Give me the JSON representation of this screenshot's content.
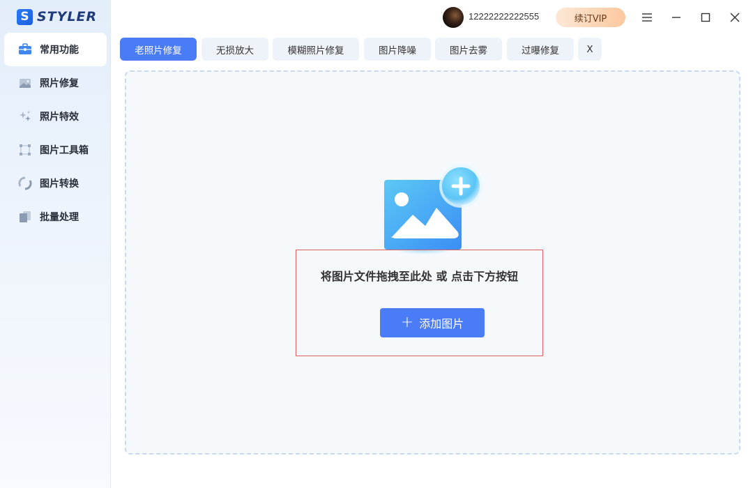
{
  "app": {
    "logo_letter": "S",
    "name": "STYLER"
  },
  "sidebar": {
    "items": [
      {
        "label": "常用功能",
        "icon": "toolbox-icon",
        "active": true
      },
      {
        "label": "照片修复",
        "icon": "photo-icon",
        "active": false
      },
      {
        "label": "照片特效",
        "icon": "sparkle-icon",
        "active": false
      },
      {
        "label": "图片工具箱",
        "icon": "crop-frame-icon",
        "active": false
      },
      {
        "label": "图片转换",
        "icon": "convert-icon",
        "active": false
      },
      {
        "label": "批量处理",
        "icon": "stack-icon",
        "active": false
      }
    ]
  },
  "titlebar": {
    "username": "12222222222555",
    "vip_label": "续订VIP",
    "window_controls": [
      "menu-icon",
      "minimize-icon",
      "maximize-icon",
      "close-icon"
    ]
  },
  "tabs": [
    {
      "label": "老照片修复",
      "active": true
    },
    {
      "label": "无损放大",
      "active": false
    },
    {
      "label": "模糊照片修复",
      "active": false
    },
    {
      "label": "图片降噪",
      "active": false
    },
    {
      "label": "图片去雾",
      "active": false
    },
    {
      "label": "过曝修复",
      "active": false
    }
  ],
  "tab_close_label": "X",
  "dropzone": {
    "hint": "将图片文件拖拽至此处 或 点击下方按钮",
    "add_button_label": "添加图片",
    "add_button_icon": "plus-icon"
  },
  "colors": {
    "accent": "#4a7cf7",
    "sidebar_bg": "#e8f0fb",
    "vip_gradient": [
      "#fde8d6",
      "#fbc89f"
    ],
    "highlight_border": "#e06060"
  }
}
